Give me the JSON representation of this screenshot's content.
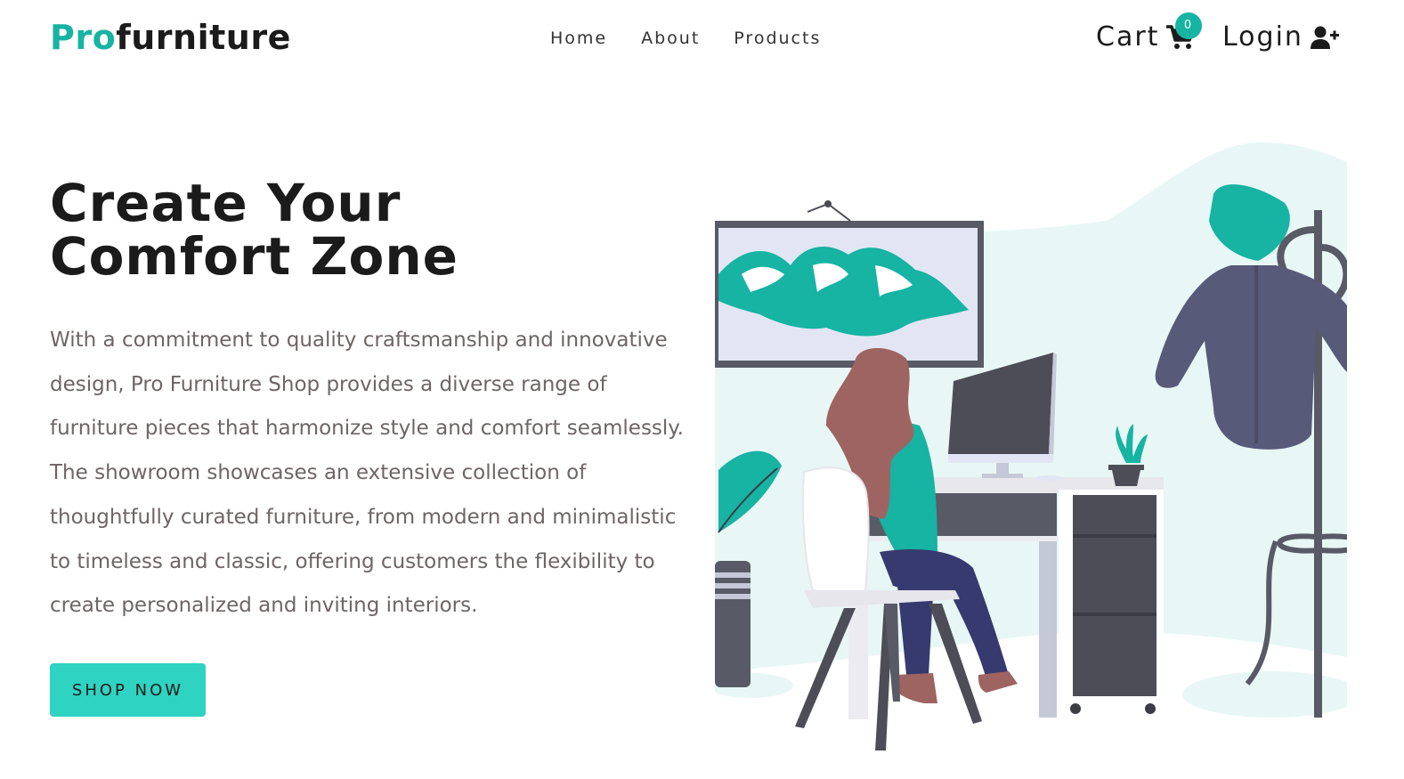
{
  "brand": {
    "pro": "Pro",
    "rest": "furniture"
  },
  "nav": {
    "items": [
      {
        "label": "Home"
      },
      {
        "label": "About"
      },
      {
        "label": "Products"
      }
    ],
    "cart_label": "Cart",
    "cart_count": "0",
    "login_label": "Login"
  },
  "hero": {
    "title_line1": "Create Your",
    "title_line2": "Comfort Zone",
    "description": "With a commitment to quality craftsmanship and innovative design, Pro Furniture Shop provides a diverse range of furniture pieces that harmonize style and comfort seamlessly. The showroom showcases an extensive collection of thoughtfully curated furniture, from modern and minimalistic to timeless and classic, offering customers the flexibility to create personalized and inviting interiors.",
    "cta_label": "SHOP NOW"
  },
  "colors": {
    "accent": "#17b3a3",
    "button": "#2ed3c1",
    "text": "#1b1b1b",
    "muted": "#6e6565"
  },
  "icons": [
    "cart-icon",
    "user-plus-icon"
  ]
}
